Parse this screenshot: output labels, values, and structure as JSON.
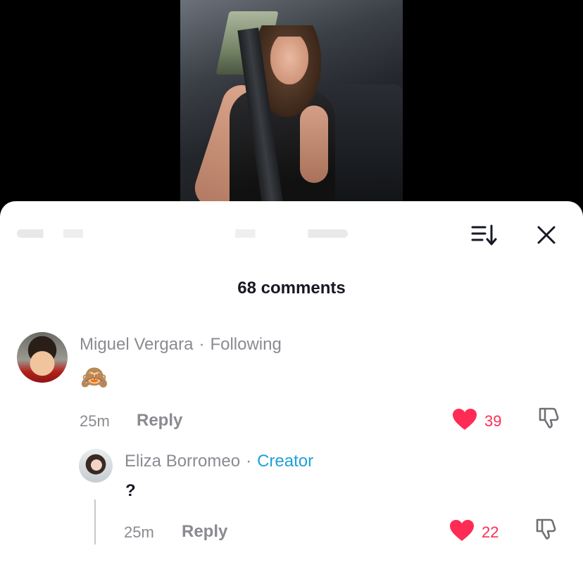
{
  "header": {
    "comment_count": "68 comments"
  },
  "icons": {
    "sort": "sort-icon",
    "close": "close-icon",
    "like": "heart-icon",
    "dislike": "dislike-icon"
  },
  "colors": {
    "like_red": "#fe2c55",
    "creator_blue": "#20a0d6",
    "muted_gray": "#8a8b91"
  },
  "comments": [
    {
      "username": "Miguel Vergara",
      "separator": "·",
      "tag": "Following",
      "text": "🙈",
      "time": "25m",
      "reply_label": "Reply",
      "likes": "39",
      "replies": [
        {
          "username": "Eliza Borromeo",
          "separator": "·",
          "tag": "Creator",
          "text": "?",
          "time": "25m",
          "reply_label": "Reply",
          "likes": "22"
        }
      ]
    }
  ]
}
